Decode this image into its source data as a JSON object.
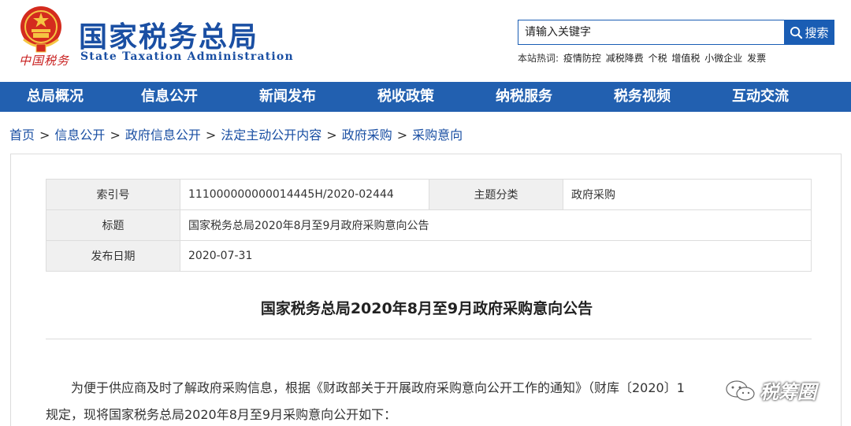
{
  "header": {
    "title_cn": "国家税务总局",
    "title_en": "State Taxation Administration",
    "seal_text": "中国税务"
  },
  "search": {
    "value": "请输入关键字",
    "button_label": "搜索"
  },
  "hot_words": {
    "label": "本站热词:",
    "items": [
      "疫情防控",
      "减税降费",
      "个税",
      "增值税",
      "小微企业",
      "发票"
    ]
  },
  "nav": {
    "items": [
      "总局概况",
      "信息公开",
      "新闻发布",
      "税收政策",
      "纳税服务",
      "税务视频",
      "互动交流"
    ]
  },
  "breadcrumb": {
    "items": [
      "首页",
      "信息公开",
      "政府信息公开",
      "法定主动公开内容",
      "政府采购",
      "采购意向"
    ],
    "separator": ">"
  },
  "meta": {
    "index_label": "索引号",
    "index_value": "111000000000014445H/2020-02444",
    "topic_label": "主题分类",
    "topic_value": "政府采购",
    "title_label": "标题",
    "title_value": "国家税务总局2020年8月至9月政府采购意向公告",
    "date_label": "发布日期",
    "date_value": "2020-07-31"
  },
  "article": {
    "title": "国家税务总局2020年8月至9月政府采购意向公告",
    "line1": "为便于供应商及时了解政府采购信息，根据《财政部关于开展政府采购意向公开工作的通知》（财库〔2020〕1",
    "line2": "规定，现将国家税务总局2020年8月至9月采购意向公开如下："
  },
  "watermark": {
    "text": "税筹圈"
  },
  "colors": {
    "brand_blue": "#2260b0",
    "title_blue": "#1a4fa3",
    "seal_red": "#c81d1d"
  }
}
